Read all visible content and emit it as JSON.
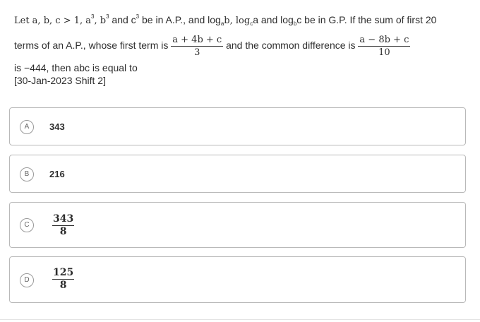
{
  "question": {
    "line1_prefix": "Let a, b, c > 1, a",
    "line1_exp_a": "3",
    "line1_comma1": ", b",
    "line1_exp_b": "3",
    "line1_and_c": " and c",
    "line1_exp_c": "3",
    "line1_text": " be in A.P., and log",
    "log1_base": "a",
    "log1_arg": "b, log",
    "log2_base": "c",
    "log2_arg": "a and log",
    "log3_base": "b",
    "log3_arg": "c be in G.P. If the sum of first 20",
    "line2_text": "terms of an A.P., whose first term is",
    "frac1_num": "a + 4b + c",
    "frac1_den": "3",
    "line2_mid": "and the common difference is",
    "frac2_num": "a − 8b + c",
    "frac2_den": "10",
    "line3_text": "is −444, then abc is equal to",
    "source": "[30-Jan-2023 Shift 2]"
  },
  "options": [
    {
      "letter": "A",
      "value": "343"
    },
    {
      "letter": "B",
      "value": "216"
    },
    {
      "letter": "C",
      "num": "343",
      "den": "8"
    },
    {
      "letter": "D",
      "num": "125",
      "den": "8"
    }
  ]
}
